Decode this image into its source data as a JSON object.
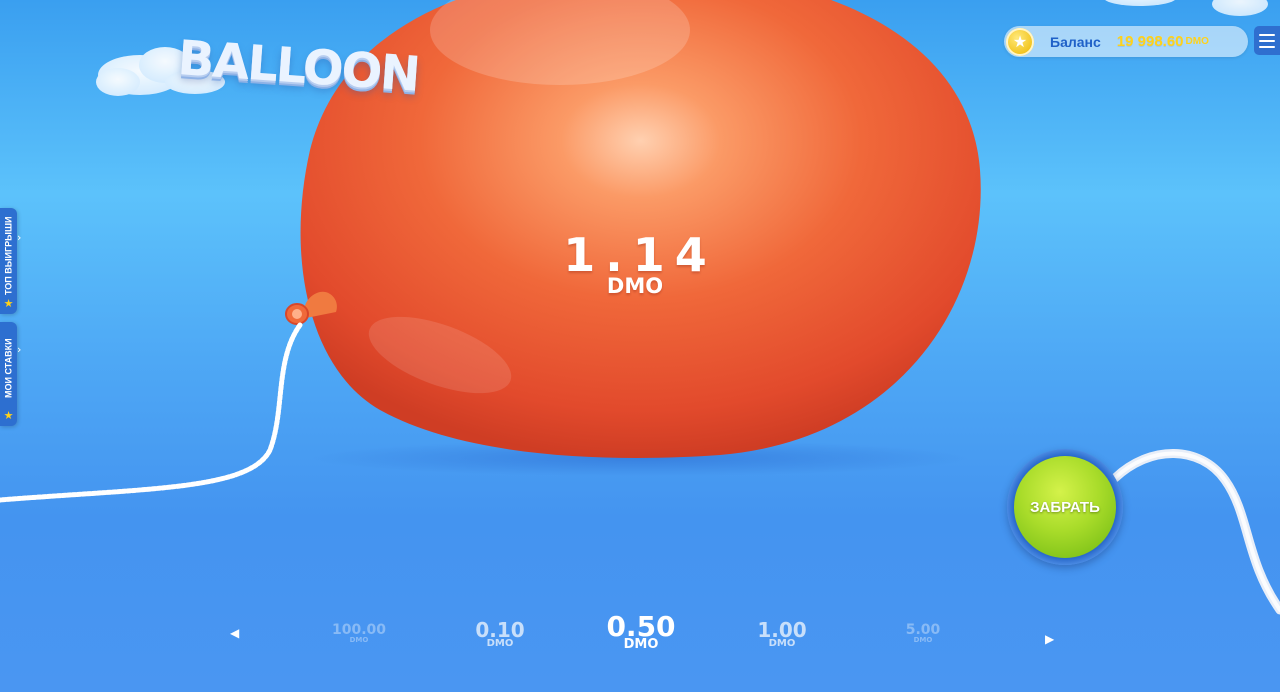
{
  "logo": {
    "text": "BALLOON"
  },
  "balance": {
    "label": "Баланс",
    "amount": "19 998.60",
    "currency": "DMO",
    "icon": "star-coin-icon"
  },
  "menu": {
    "icon": "hamburger-menu-icon"
  },
  "side_tabs": [
    {
      "label": "ТОП ВЫИГРЫШИ",
      "icon": "star-icon"
    },
    {
      "label": "МОИ СТАВКИ",
      "icon": "star-icon"
    }
  ],
  "game": {
    "multiplier": "1.14",
    "currency": "DMO",
    "balloon_color": "#f0683a"
  },
  "cashout": {
    "label": "ЗАБРАТЬ",
    "color": "#9fd62a"
  },
  "bets": {
    "prev_icon": "triangle-left-icon",
    "next_icon": "triangle-right-icon",
    "options": [
      {
        "value": "100.00",
        "currency": "DMO"
      },
      {
        "value": "0.10",
        "currency": "DMO"
      },
      {
        "value": "0.50",
        "currency": "DMO",
        "selected": true
      },
      {
        "value": "1.00",
        "currency": "DMO"
      },
      {
        "value": "5.00",
        "currency": "DMO"
      }
    ]
  }
}
